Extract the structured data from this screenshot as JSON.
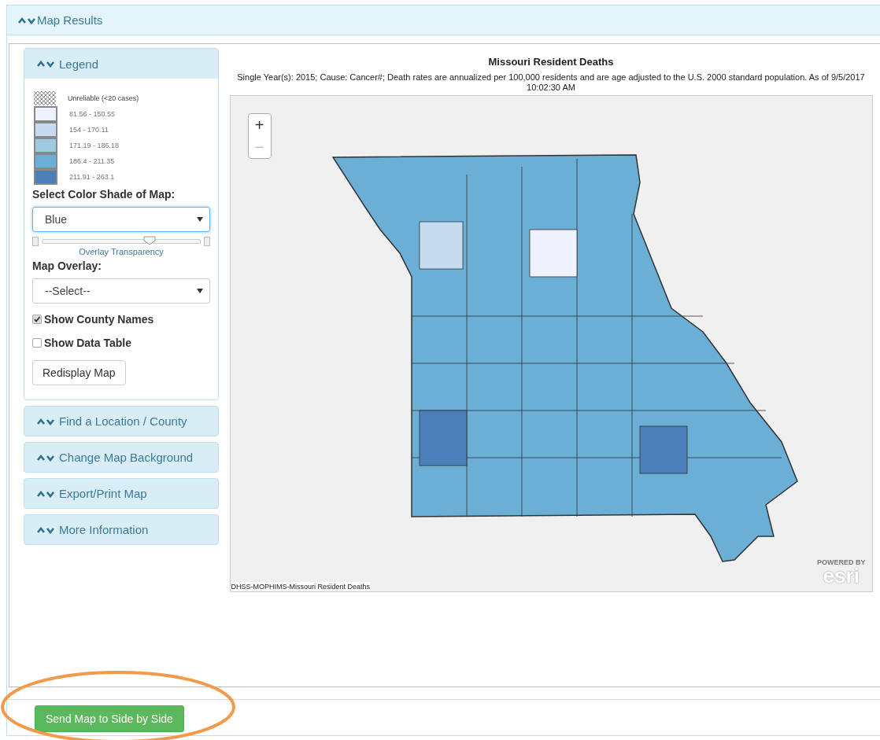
{
  "panel": {
    "title": "Map Results"
  },
  "legend": {
    "title": "Legend",
    "items": [
      {
        "kind": "hatch",
        "label": "Unreliable (<20 cases)"
      },
      {
        "kind": "swatch",
        "label": "81.56 - 150.55",
        "color": "#eff3ff"
      },
      {
        "kind": "swatch",
        "label": "154 - 170.11",
        "color": "#c6dbef"
      },
      {
        "kind": "swatch",
        "label": "171.19 - 186.18",
        "color": "#9ecae1"
      },
      {
        "kind": "swatch",
        "label": "186.4 - 211.35",
        "color": "#6baed6"
      },
      {
        "kind": "swatch",
        "label": "211.91 - 263.1",
        "color": "#4a7fb8"
      }
    ],
    "shade_label": "Select Color Shade of Map:",
    "shade_value": "Blue",
    "transparency": {
      "label": "Overlay Transparency",
      "level": 0.68
    },
    "overlay_label": "Map Overlay:",
    "overlay_value": "--Select--",
    "checkboxes": [
      {
        "label": "Show County Names",
        "checked": true
      },
      {
        "label": "Show Data Table",
        "checked": false
      }
    ],
    "button": "Redisplay Map"
  },
  "sections": [
    "Find a Location / County",
    "Change Map Background",
    "Export/Print Map",
    "More Information"
  ],
  "map": {
    "title": "Missouri Resident Deaths",
    "subtitle": "Single Year(s): 2015; Cause: Cancer#; Death rates are annualized per 100,000 residents and are age adjusted to the U.S. 2000 standard population. As of 9/5/2017 10:02:30 AM",
    "zoom_in": "+",
    "zoom_out": "−",
    "attribution": "DHSS-MOPHIMS-Missouri Resident Deaths",
    "logo_top": "POWERED BY",
    "logo": "esri"
  },
  "footer_button": "Send Map to Side by Side"
}
